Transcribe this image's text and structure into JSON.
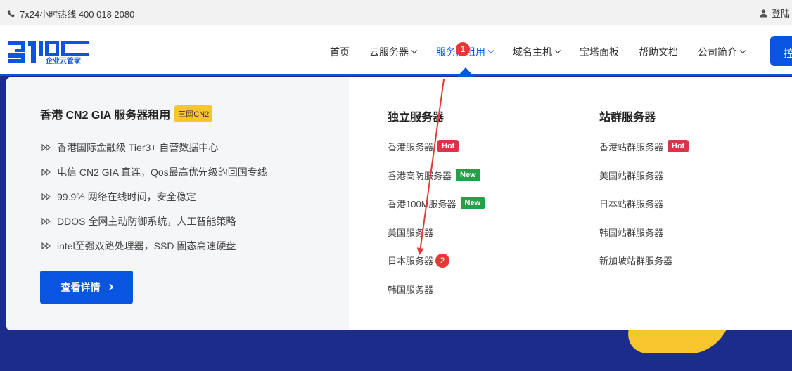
{
  "topbar": {
    "phone_text": "7x24小时热线 400 018 2080",
    "login_text": "登陆"
  },
  "header": {
    "logo_text": "31IDC",
    "logo_sub": "企业云管家",
    "nav": [
      {
        "label": "首页",
        "has_dropdown": false
      },
      {
        "label": "云服务器",
        "has_dropdown": true
      },
      {
        "label": "服务器租用",
        "has_dropdown": true,
        "active": true
      },
      {
        "label": "域名主机",
        "has_dropdown": true
      },
      {
        "label": "宝塔面板",
        "has_dropdown": false
      },
      {
        "label": "帮助文档",
        "has_dropdown": false
      },
      {
        "label": "公司简介",
        "has_dropdown": true
      }
    ],
    "cta_label": "控"
  },
  "dropdown": {
    "left": {
      "title": "香港 CN2 GIA 服务器租用",
      "tag": "三网CN2",
      "features": [
        "香港国际金融级 Tier3+ 自营数据中心",
        "电信 CN2 GIA 直连，Qos最高优先级的回国专线",
        "99.9% 网络在线时间，安全稳定",
        "DDOS 全网主动防御系统，人工智能策略",
        "intel至强双路处理器，SSD 固态高速硬盘"
      ],
      "button_label": "查看详情"
    },
    "columns": [
      {
        "title": "独立服务器",
        "items": [
          {
            "label": "香港服务器",
            "badge": "Hot",
            "badge_type": "hot"
          },
          {
            "label": "香港高防服务器",
            "badge": "New",
            "badge_type": "new"
          },
          {
            "label": "香港100M服务器",
            "badge": "New",
            "badge_type": "new"
          },
          {
            "label": "美国服务器",
            "badge": "",
            "badge_type": ""
          },
          {
            "label": "日本服务器",
            "badge": "",
            "badge_type": ""
          },
          {
            "label": "韩国服务器",
            "badge": "",
            "badge_type": ""
          }
        ]
      },
      {
        "title": "站群服务器",
        "items": [
          {
            "label": "香港站群服务器",
            "badge": "Hot",
            "badge_type": "hot"
          },
          {
            "label": "美国站群服务器",
            "badge": "",
            "badge_type": ""
          },
          {
            "label": "日本站群服务器",
            "badge": "",
            "badge_type": ""
          },
          {
            "label": "韩国站群服务器",
            "badge": "",
            "badge_type": ""
          },
          {
            "label": "新加坡站群服务器",
            "badge": "",
            "badge_type": ""
          }
        ]
      }
    ]
  },
  "annotations": {
    "marker_1": "1",
    "marker_2": "2"
  },
  "colors": {
    "accent": "#0a55e0",
    "hot": "#d9344a",
    "new": "#24a148",
    "tag": "#f7c62f",
    "annotation": "#e53935"
  }
}
